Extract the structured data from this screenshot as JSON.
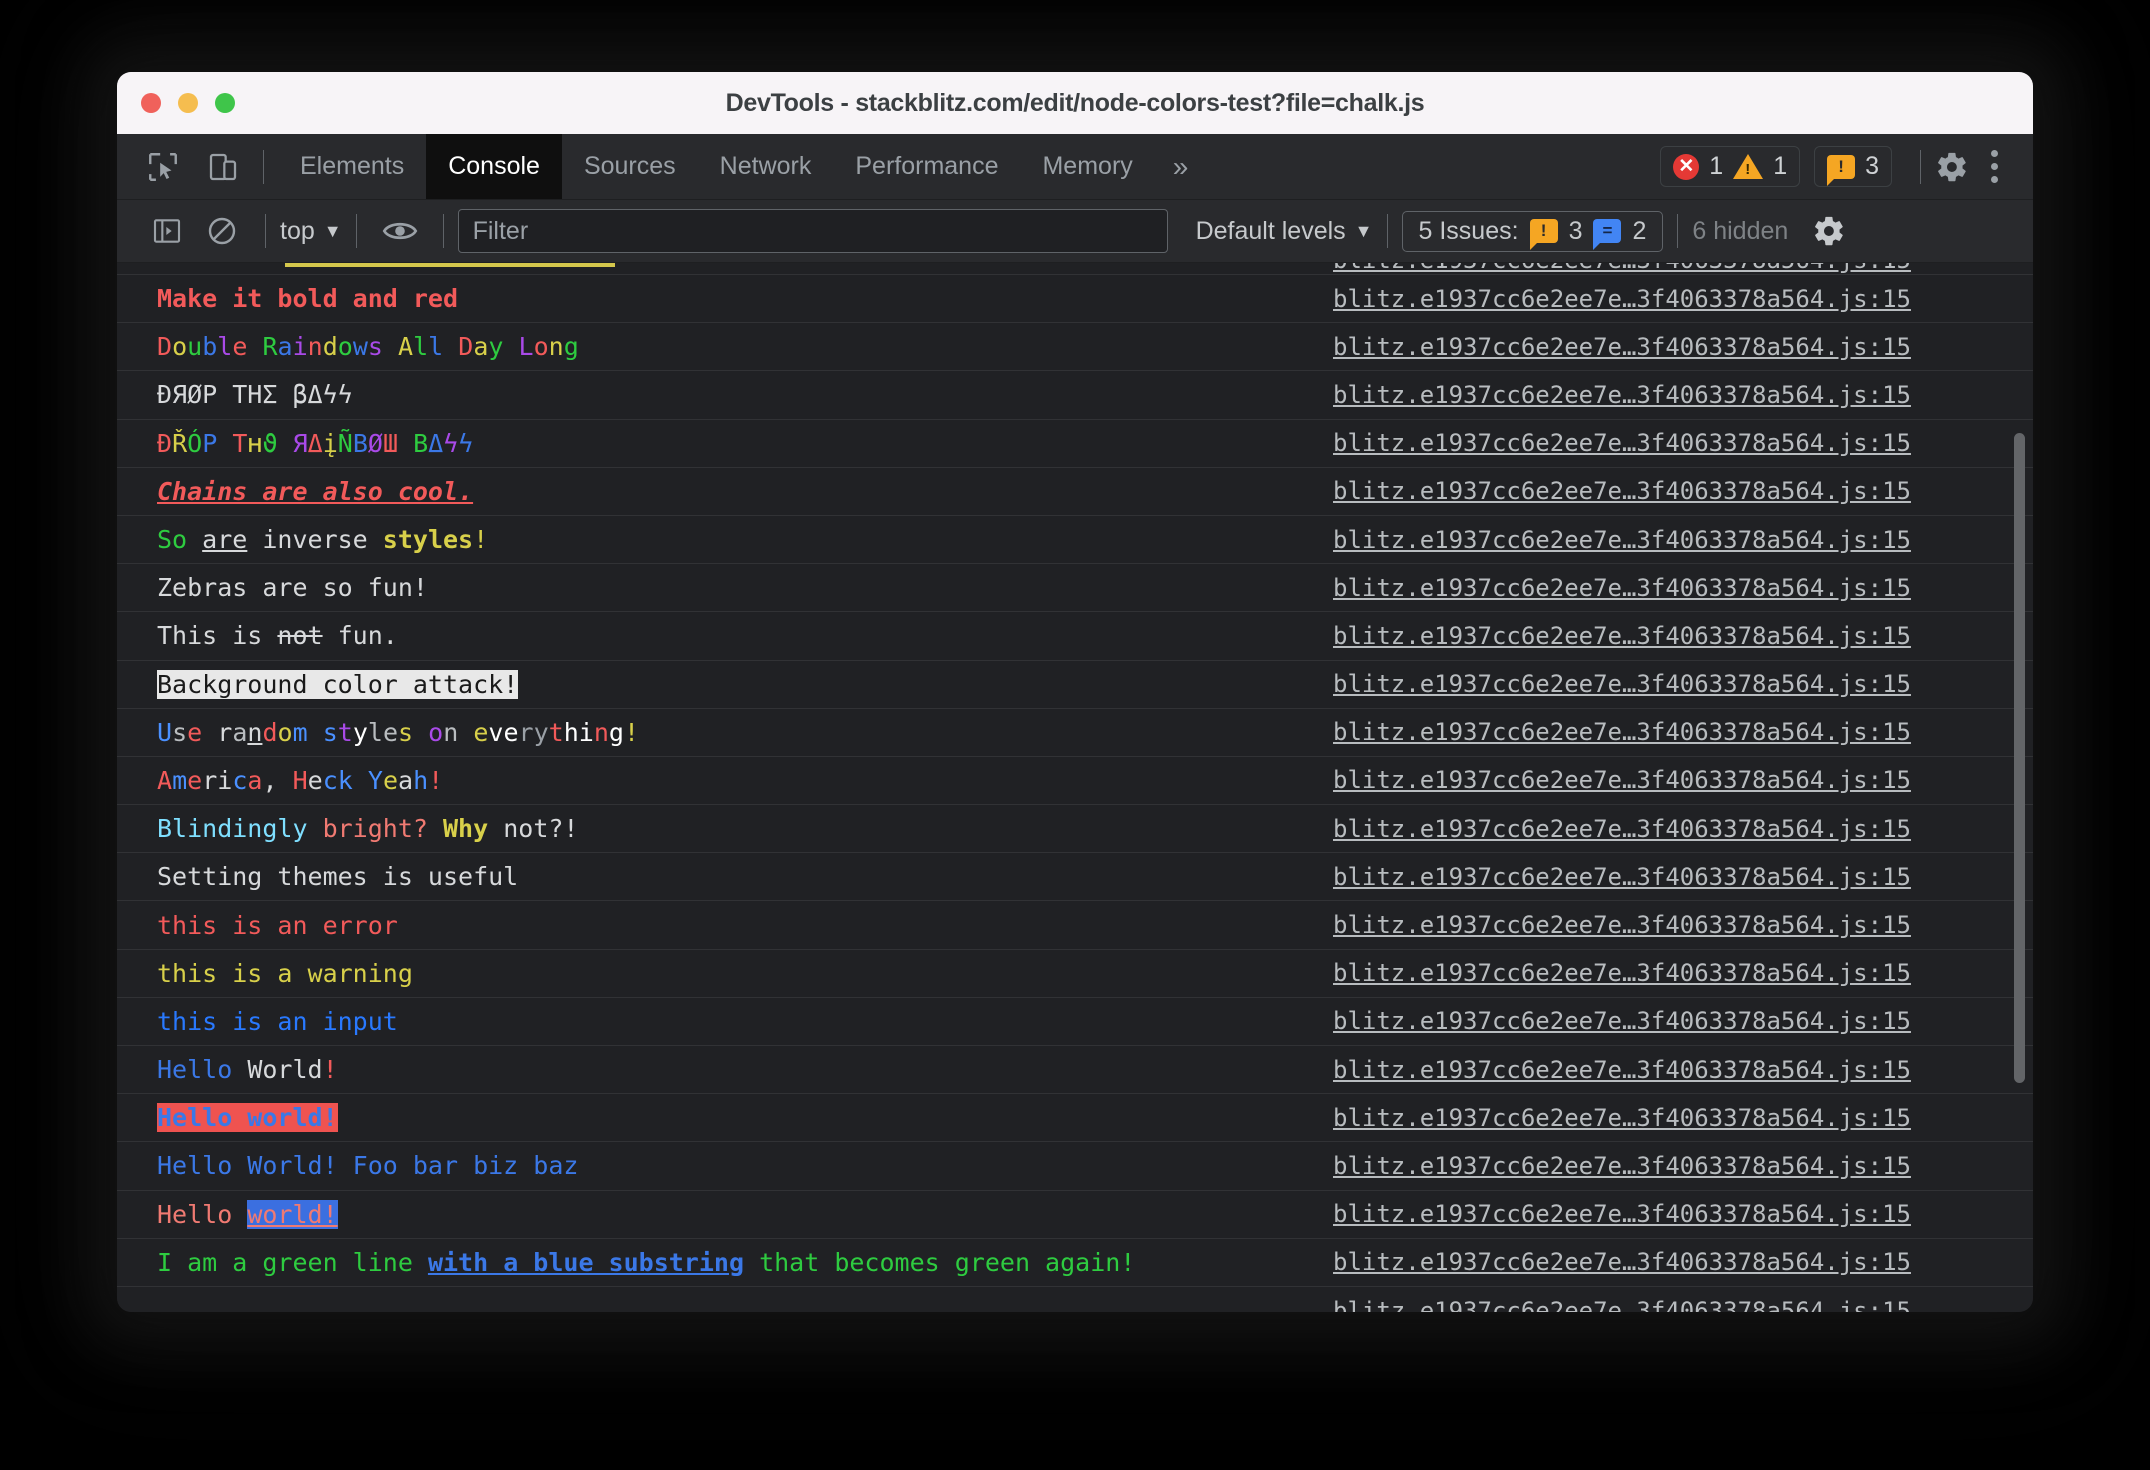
{
  "window": {
    "title": "DevTools - stackblitz.com/edit/node-colors-test?file=chalk.js",
    "traffic_lights": [
      "close-button",
      "minimize-button",
      "zoom-button"
    ]
  },
  "tabstrip": {
    "inspect_icon": "inspect-element-icon",
    "device_icon": "device-toolbar-icon",
    "tabs": [
      {
        "label": "Elements",
        "active": false
      },
      {
        "label": "Console",
        "active": true
      },
      {
        "label": "Sources",
        "active": false
      },
      {
        "label": "Network",
        "active": false
      },
      {
        "label": "Performance",
        "active": false
      },
      {
        "label": "Memory",
        "active": false
      }
    ],
    "more_tabs": "»",
    "error_count": "1",
    "warning_count": "1",
    "issue_count": "3",
    "issue_glyph": "!",
    "settings_icon": "gear-icon",
    "more_icon": "kebab-menu-icon"
  },
  "console_toolbar": {
    "sidebar_icon": "console-sidebar-icon",
    "clear_icon": "clear-console-icon",
    "context_label": "top",
    "context_caret": "▼",
    "eye_icon": "live-expression-eye-icon",
    "filter_placeholder": "Filter",
    "filter_value": "",
    "levels_label": "Default levels",
    "levels_caret": "▼",
    "issues_label": "5 Issues:",
    "issues_orange_count": "3",
    "issues_blue_count": "2",
    "issues_orange_glyph": "!",
    "issues_blue_glyph": "=",
    "hidden_label": "6 hidden",
    "settings_icon": "console-settings-gear-icon"
  },
  "colors": {
    "red": "#f25a5a",
    "bright_red": "#ff5f56",
    "green": "#2ecc40",
    "bright_green": "#35d435",
    "yellow": "#d8d04a",
    "blue": "#3b78e7",
    "bright_blue": "#4a90ff",
    "magenta": "#a94ae8",
    "cyan": "#7fdfff",
    "white": "#d7d9db",
    "gray": "#9aa0a6",
    "salmon": "#f07a72",
    "bg_white": "#e8e8e8",
    "bg_red": "#ef5350",
    "bg_blue": "#3b6fe0"
  },
  "source_link": "blitz.e1937cc6e2ee7e…3f4063378a564.js:15",
  "console_messages": [
    {
      "id": "clipped-top",
      "plain": "",
      "runs": []
    },
    {
      "id": "make-it-bold-and-red",
      "plain": "Make it bold and red",
      "runs": [
        {
          "t": "Make it bold and red",
          "c": "#f25a5a",
          "st": "b"
        }
      ]
    },
    {
      "id": "double-rainbows",
      "plain": "Double Raindows All Day Long",
      "runs": [
        {
          "t": "D",
          "c": "#f25a5a"
        },
        {
          "t": "o",
          "c": "#d8d04a"
        },
        {
          "t": "u",
          "c": "#2ecc40"
        },
        {
          "t": "b",
          "c": "#3b78e7"
        },
        {
          "t": "l",
          "c": "#a94ae8"
        },
        {
          "t": "e",
          "c": "#f25a5a"
        },
        {
          "t": " ",
          "c": "#d7d9db"
        },
        {
          "t": "R",
          "c": "#2ecc40"
        },
        {
          "t": "a",
          "c": "#3b78e7"
        },
        {
          "t": "i",
          "c": "#a94ae8"
        },
        {
          "t": "n",
          "c": "#f25a5a"
        },
        {
          "t": "d",
          "c": "#d8d04a"
        },
        {
          "t": "o",
          "c": "#2ecc40"
        },
        {
          "t": "w",
          "c": "#3b78e7"
        },
        {
          "t": "s",
          "c": "#a94ae8"
        },
        {
          "t": " ",
          "c": "#d7d9db"
        },
        {
          "t": "A",
          "c": "#d8d04a"
        },
        {
          "t": "l",
          "c": "#2ecc40"
        },
        {
          "t": "l",
          "c": "#3b78e7"
        },
        {
          "t": " ",
          "c": "#d7d9db"
        },
        {
          "t": "D",
          "c": "#f25a5a"
        },
        {
          "t": "a",
          "c": "#d8d04a"
        },
        {
          "t": "y",
          "c": "#2ecc40"
        },
        {
          "t": " ",
          "c": "#d7d9db"
        },
        {
          "t": "L",
          "c": "#a94ae8"
        },
        {
          "t": "o",
          "c": "#f25a5a"
        },
        {
          "t": "n",
          "c": "#d8d04a"
        },
        {
          "t": "g",
          "c": "#2ecc40"
        }
      ]
    },
    {
      "id": "drop-the-bass-plain",
      "plain": "ÐЯØP THΣ βΔϟϟ",
      "runs": [
        {
          "t": "ÐЯØP THΣ βΔϟϟ",
          "c": "#d7d9db"
        }
      ]
    },
    {
      "id": "drop-the-rainbow-bass",
      "plain": "ÐŘÓP Tʜϑ ЯΔįÑВØШ ВΔϟϟ",
      "runs": [
        {
          "t": "Ð",
          "c": "#f25a5a"
        },
        {
          "t": "Ř",
          "c": "#d8d04a"
        },
        {
          "t": "Ó",
          "c": "#2ecc40"
        },
        {
          "t": "P",
          "c": "#3b78e7"
        },
        {
          "t": " ",
          "c": "#d7d9db"
        },
        {
          "t": "T",
          "c": "#f25a5a"
        },
        {
          "t": "ʜ",
          "c": "#d8d04a"
        },
        {
          "t": "ϑ",
          "c": "#2ecc40"
        },
        {
          "t": " ",
          "c": "#d7d9db"
        },
        {
          "t": "Я",
          "c": "#a94ae8"
        },
        {
          "t": "Δ",
          "c": "#f25a5a"
        },
        {
          "t": "į",
          "c": "#d8d04a"
        },
        {
          "t": "Ñ",
          "c": "#2ecc40"
        },
        {
          "t": "В",
          "c": "#3b78e7"
        },
        {
          "t": "Ø",
          "c": "#a94ae8"
        },
        {
          "t": "Ш",
          "c": "#f25a5a"
        },
        {
          "t": " ",
          "c": "#d7d9db"
        },
        {
          "t": "В",
          "c": "#2ecc40"
        },
        {
          "t": "Δ",
          "c": "#3b78e7"
        },
        {
          "t": "ϟ",
          "c": "#a94ae8"
        },
        {
          "t": "ϟ",
          "c": "#3b78e7"
        }
      ]
    },
    {
      "id": "chains-are-also-cool",
      "plain": "Chains are also cool.",
      "runs": [
        {
          "t": "Chains are also cool.",
          "c": "#f25a5a",
          "st": "biu"
        }
      ]
    },
    {
      "id": "so-are-inverse-styles",
      "plain": "So are inverse styles!",
      "runs": [
        {
          "t": "So",
          "c": "#2ecc40"
        },
        {
          "t": " ",
          "c": "#d7d9db"
        },
        {
          "t": "are",
          "c": "#d7d9db",
          "st": "u"
        },
        {
          "t": " inverse ",
          "c": "#d7d9db"
        },
        {
          "t": "styles",
          "c": "#d8d04a",
          "st": "b"
        },
        {
          "t": "!",
          "c": "#d8d04a"
        }
      ]
    },
    {
      "id": "zebras-are-so-fun",
      "plain": "Zebras are so fun!",
      "runs": [
        {
          "t": "Zebras are so fun!",
          "c": "#d7d9db"
        }
      ]
    },
    {
      "id": "this-is-not-fun",
      "plain": "This is not fun.",
      "runs": [
        {
          "t": "This is ",
          "c": "#d7d9db"
        },
        {
          "t": "not",
          "c": "#d7d9db",
          "st": "s"
        },
        {
          "t": " fun.",
          "c": "#d7d9db"
        }
      ]
    },
    {
      "id": "background-color-attack",
      "plain": "Background color attack!",
      "runs": [
        {
          "t": "Background color attack!",
          "c": "#1a1a1a",
          "bg": "#e8e8e8"
        }
      ]
    },
    {
      "id": "use-random-styles",
      "plain": "Use random styles on everything!",
      "runs": [
        {
          "t": "U",
          "c": "#4a90ff"
        },
        {
          "t": "s",
          "c": "#b9bdc0"
        },
        {
          "t": "e",
          "c": "#f25a5a"
        },
        {
          "t": " ",
          "c": "#d7d9db"
        },
        {
          "t": "r",
          "c": "#d7d9db"
        },
        {
          "t": "a",
          "c": "#b9bdc0"
        },
        {
          "t": "n",
          "c": "#d7d9db",
          "st": "u"
        },
        {
          "t": "d",
          "c": "#f25a5a"
        },
        {
          "t": "o",
          "c": "#d8d04a"
        },
        {
          "t": "m",
          "c": "#4a90ff"
        },
        {
          "t": " ",
          "c": "#d7d9db"
        },
        {
          "t": "s",
          "c": "#4a90ff"
        },
        {
          "t": "t",
          "c": "#a94ae8"
        },
        {
          "t": "y",
          "c": "#ffffff"
        },
        {
          "t": "l",
          "c": "#b9bdc0"
        },
        {
          "t": "e",
          "c": "#b9bdc0"
        },
        {
          "t": "s",
          "c": "#d8d04a"
        },
        {
          "t": " ",
          "c": "#d7d9db"
        },
        {
          "t": "o",
          "c": "#a94ae8"
        },
        {
          "t": "n",
          "c": "#b9bdc0"
        },
        {
          "t": " ",
          "c": "#d7d9db"
        },
        {
          "t": "e",
          "c": "#d8d04a"
        },
        {
          "t": "v",
          "c": "#ffffff"
        },
        {
          "t": "e",
          "c": "#ffffff"
        },
        {
          "t": "r",
          "c": "#9aa0a6"
        },
        {
          "t": "y",
          "c": "#9aa0a6"
        },
        {
          "t": "t",
          "c": "#f25a5a"
        },
        {
          "t": "h",
          "c": "#ffffff"
        },
        {
          "t": "i",
          "c": "#ffffff"
        },
        {
          "t": "n",
          "c": "#f25a5a"
        },
        {
          "t": "g",
          "c": "#ffffff"
        },
        {
          "t": "!",
          "c": "#d8d04a"
        }
      ]
    },
    {
      "id": "america-heck-yeah",
      "plain": "America, Heck Yeah!",
      "runs": [
        {
          "t": "A",
          "c": "#f25a5a"
        },
        {
          "t": "m",
          "c": "#4a90ff"
        },
        {
          "t": "e",
          "c": "#f25a5a"
        },
        {
          "t": "r",
          "c": "#d7d9db"
        },
        {
          "t": "i",
          "c": "#d7d9db"
        },
        {
          "t": "c",
          "c": "#4a90ff"
        },
        {
          "t": "a",
          "c": "#f25a5a"
        },
        {
          "t": ",",
          "c": "#d7d9db"
        },
        {
          "t": " ",
          "c": "#d7d9db"
        },
        {
          "t": "H",
          "c": "#f25a5a"
        },
        {
          "t": "e",
          "c": "#d7d9db"
        },
        {
          "t": "c",
          "c": "#4a90ff"
        },
        {
          "t": "k",
          "c": "#4a90ff"
        },
        {
          "t": " ",
          "c": "#d7d9db"
        },
        {
          "t": "Y",
          "c": "#4a90ff"
        },
        {
          "t": "e",
          "c": "#d8d04a"
        },
        {
          "t": "a",
          "c": "#d7d9db"
        },
        {
          "t": "h",
          "c": "#4a90ff"
        },
        {
          "t": "!",
          "c": "#f25a5a"
        }
      ]
    },
    {
      "id": "blindingly-bright",
      "plain": "Blindingly bright? Why not?!",
      "runs": [
        {
          "t": "Blindingly",
          "c": "#7fdfff"
        },
        {
          "t": " ",
          "c": "#d7d9db"
        },
        {
          "t": "bright?",
          "c": "#f07a72"
        },
        {
          "t": " ",
          "c": "#d7d9db"
        },
        {
          "t": "Why",
          "c": "#d8d04a",
          "st": "b"
        },
        {
          "t": " ",
          "c": "#d7d9db"
        },
        {
          "t": "not?!",
          "c": "#d7d9db"
        }
      ]
    },
    {
      "id": "setting-themes-is-useful",
      "plain": "Setting themes is useful",
      "runs": [
        {
          "t": "Setting themes is useful",
          "c": "#d7d9db"
        }
      ]
    },
    {
      "id": "this-is-an-error",
      "plain": "this is an error",
      "runs": [
        {
          "t": "this is an error",
          "c": "#f25a5a"
        }
      ]
    },
    {
      "id": "this-is-a-warning",
      "plain": "this is a warning",
      "runs": [
        {
          "t": "this is a warning",
          "c": "#d8d04a"
        }
      ]
    },
    {
      "id": "this-is-an-input",
      "plain": "this is an input",
      "runs": [
        {
          "t": "this is an input",
          "c": "#2979ff"
        }
      ]
    },
    {
      "id": "hello-world-mixed",
      "plain": "Hello World!",
      "runs": [
        {
          "t": "Hello",
          "c": "#3b78e7"
        },
        {
          "t": " ",
          "c": "#d7d9db"
        },
        {
          "t": "World",
          "c": "#d7d9db"
        },
        {
          "t": "!",
          "c": "#f25a5a"
        }
      ]
    },
    {
      "id": "hello-world-red-bg",
      "plain": "Hello world!",
      "runs": [
        {
          "t": "Hello world!",
          "c": "#3b78e7",
          "bg": "#ef5350",
          "st": "b"
        }
      ]
    },
    {
      "id": "hello-world-foo-bar",
      "plain": "Hello World! Foo bar biz baz",
      "runs": [
        {
          "t": "Hello World! Foo bar biz baz",
          "c": "#3b78e7"
        }
      ]
    },
    {
      "id": "hello-world-blue-bg",
      "plain": "Hello world!",
      "runs": [
        {
          "t": "Hello",
          "c": "#f07a72"
        },
        {
          "t": " ",
          "c": "#d7d9db"
        },
        {
          "t": "world!",
          "c": "#f07a72",
          "bg": "#3b6fe0",
          "st": "u"
        }
      ]
    },
    {
      "id": "green-line-blue-substring",
      "plain": "I am a green line with a blue substring that becomes green again!",
      "runs": [
        {
          "t": "I am a green line ",
          "c": "#2ecc40"
        },
        {
          "t": "with a blue substring",
          "c": "#3b78e7",
          "st": "bu"
        },
        {
          "t": " that becomes green again!",
          "c": "#2ecc40"
        }
      ]
    },
    {
      "id": "clipped-bottom",
      "plain": "",
      "runs": []
    }
  ]
}
